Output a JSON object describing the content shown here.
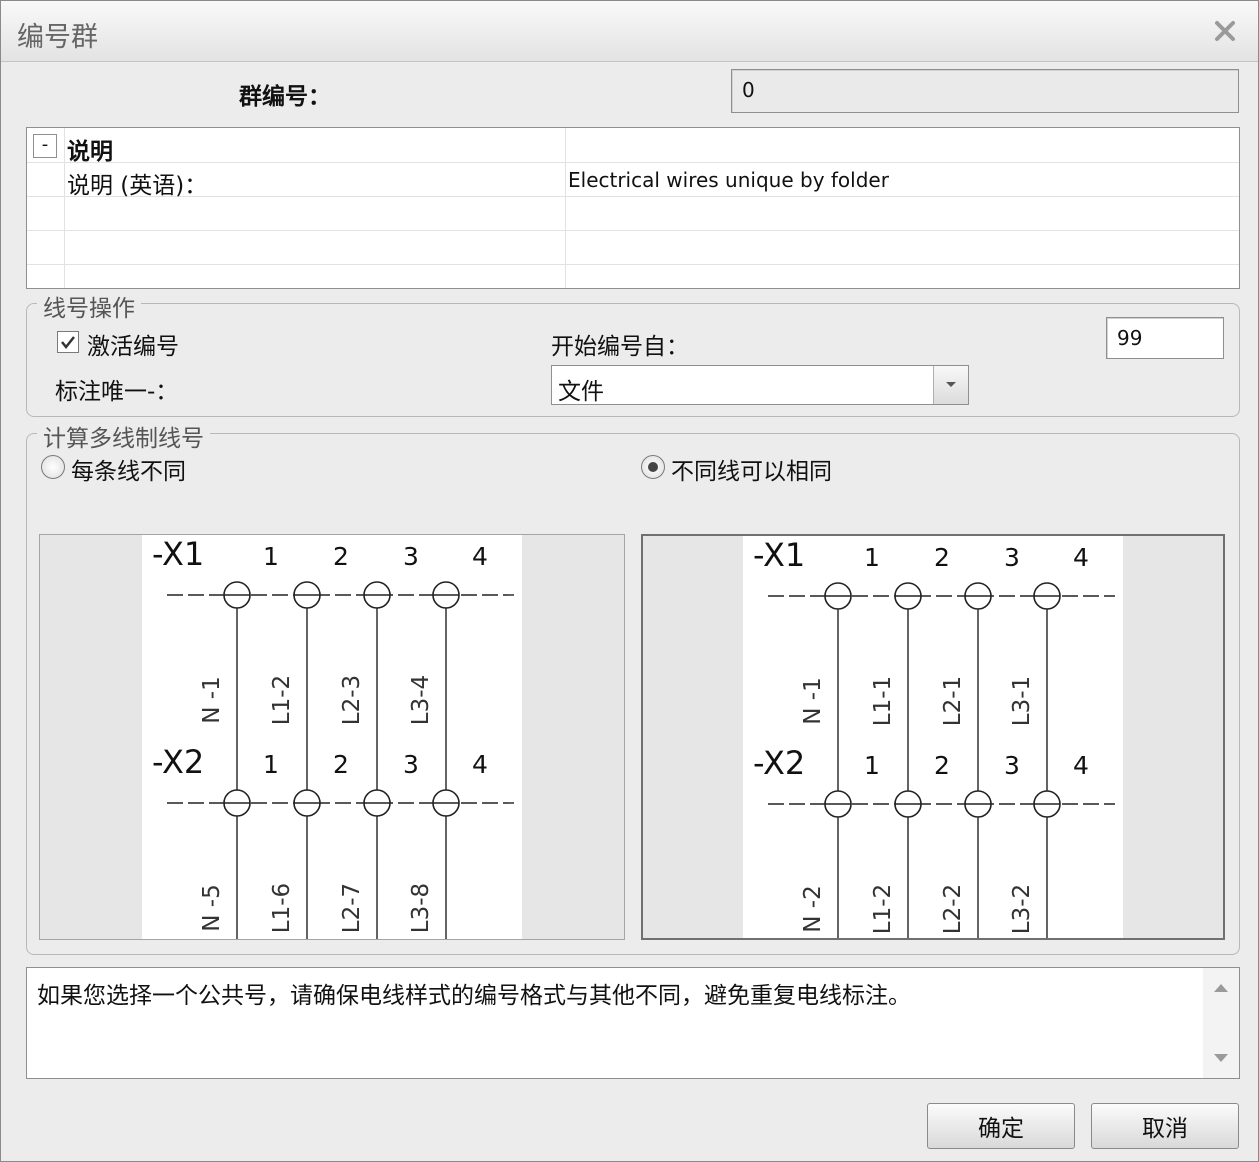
{
  "window": {
    "title": "编号群"
  },
  "group_number": {
    "label": "群编号：",
    "value": "0"
  },
  "properties": {
    "section_label": "说明",
    "expander": "-",
    "rows": [
      {
        "name": "说明 (英语)：",
        "value": "Electrical wires unique by folder"
      }
    ]
  },
  "wire_ops": {
    "legend": "线号操作",
    "activate_label": "激活编号",
    "activate_checked": true,
    "start_label": "开始编号自：",
    "start_value": "99",
    "unique_label": "标注唯一-：",
    "unique_value": "文件"
  },
  "multiline": {
    "legend": "计算多线制线号",
    "option_left": "每条线不同",
    "option_right": "不同线可以相同",
    "selected": "right",
    "previews": [
      {
        "top_ref": "-X1",
        "bottom_ref": "-X2",
        "terminals": [
          "1",
          "2",
          "3",
          "4"
        ],
        "upper_wires": [
          "N -1",
          "L1-2",
          "L2-3",
          "L3-4"
        ],
        "lower_wires": [
          "N -5",
          "L1-6",
          "L2-7",
          "L3-8"
        ]
      },
      {
        "top_ref": "-X1",
        "bottom_ref": "-X2",
        "terminals": [
          "1",
          "2",
          "3",
          "4"
        ],
        "upper_wires": [
          "N -1",
          "L1-1",
          "L2-1",
          "L3-1"
        ],
        "lower_wires": [
          "N -2",
          "L1-2",
          "L2-2",
          "L3-2"
        ]
      }
    ]
  },
  "message": "如果您选择一个公共号，请确保电线样式的编号格式与其他不同，避免重复电线标注。",
  "buttons": {
    "ok": "确定",
    "cancel": "取消"
  }
}
